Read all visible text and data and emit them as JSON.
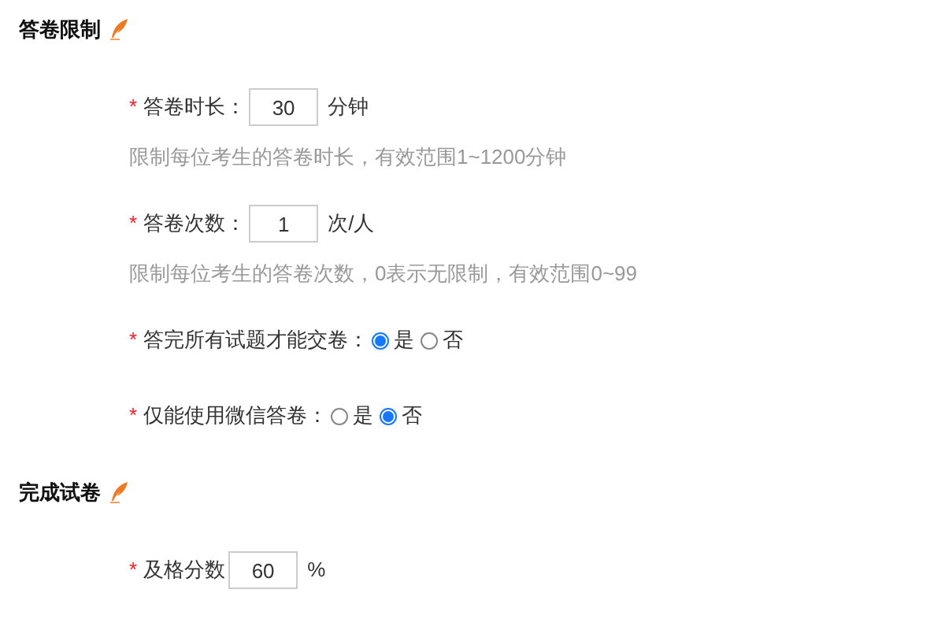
{
  "sections": [
    {
      "title": "答卷限制",
      "fields": [
        {
          "kind": "number",
          "mark": "*",
          "label": "答卷时长：",
          "value": "30",
          "unit": "分钟",
          "hint": "限制每位考生的答卷时长，有效范围1~1200分钟"
        },
        {
          "kind": "number",
          "mark": "*",
          "label": "答卷次数：",
          "value": "1",
          "unit": "次/人",
          "hint": "限制每位考生的答卷次数，0表示无限制，有效范围0~99"
        },
        {
          "kind": "radio",
          "mark": "*",
          "label": "答完所有试题才能交卷：",
          "options": [
            {
              "label": "是",
              "selected": true
            },
            {
              "label": "否",
              "selected": false
            }
          ]
        },
        {
          "kind": "radio",
          "mark": "*",
          "label": "仅能使用微信答卷：",
          "options": [
            {
              "label": "是",
              "selected": false
            },
            {
              "label": "否",
              "selected": true
            }
          ]
        }
      ]
    },
    {
      "title": "完成试卷",
      "fields": [
        {
          "kind": "number",
          "mark": "*",
          "label": "及格分数",
          "value": "60",
          "unit": "%"
        }
      ]
    }
  ]
}
